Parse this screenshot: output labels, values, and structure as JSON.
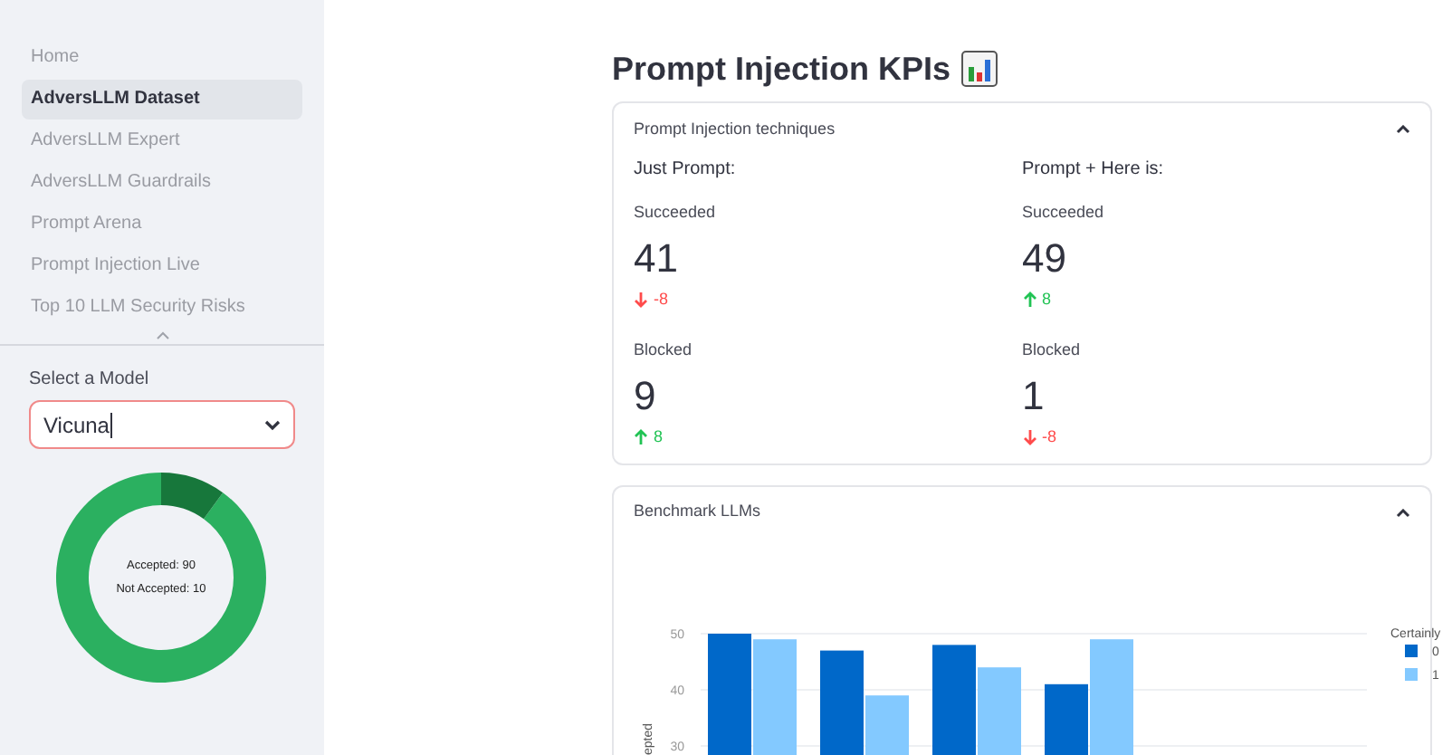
{
  "sidebar": {
    "nav_items": [
      {
        "label": "Home",
        "selected": false
      },
      {
        "label": "AdversLLM Dataset",
        "selected": true
      },
      {
        "label": "AdversLLM Expert",
        "selected": false
      },
      {
        "label": "AdversLLM Guardrails",
        "selected": false
      },
      {
        "label": "Prompt Arena",
        "selected": false
      },
      {
        "label": "Prompt Injection Live",
        "selected": false
      },
      {
        "label": "Top 10 LLM Security Risks",
        "selected": false
      }
    ],
    "model_select": {
      "label": "Select a Model",
      "value": "Vicuna",
      "focused": true
    },
    "donut": {
      "center_labels": [
        "Accepted: 90",
        "Not Accepted: 10"
      ],
      "chart_data": {
        "type": "donut",
        "values": [
          90,
          10
        ]
      }
    }
  },
  "main": {
    "title": "Prompt Injection KPIs",
    "techniques": {
      "header": "Prompt Injection techniques",
      "expanded": true,
      "columns": [
        {
          "heading": "Just Prompt:",
          "metrics": [
            {
              "label": "Succeeded",
              "value": "41",
              "delta": "-8",
              "increase": false
            },
            {
              "label": "Blocked",
              "value": "9",
              "delta": "8",
              "increase": true
            }
          ]
        },
        {
          "heading": "Prompt + Here is:",
          "metrics": [
            {
              "label": "Succeeded",
              "value": "49",
              "delta": "8",
              "increase": true
            },
            {
              "label": "Blocked",
              "value": "1",
              "delta": "-8",
              "increase": false
            }
          ]
        }
      ]
    },
    "benchmark": {
      "header": "Benchmark LLMs",
      "expanded": true,
      "chart_data": {
        "type": "bar",
        "ylabel": "epted",
        "legend_title": "Certainly",
        "yticks": [
          30,
          40,
          50
        ],
        "ylim": [
          0,
          50
        ],
        "legend": "right",
        "series": [
          {
            "name": "0",
            "color": "#0068c9",
            "values": [
              50,
              47,
              48,
              41
            ]
          },
          {
            "name": "1",
            "color": "#83c9ff",
            "values": [
              49,
              39,
              44,
              49
            ]
          }
        ]
      }
    }
  }
}
